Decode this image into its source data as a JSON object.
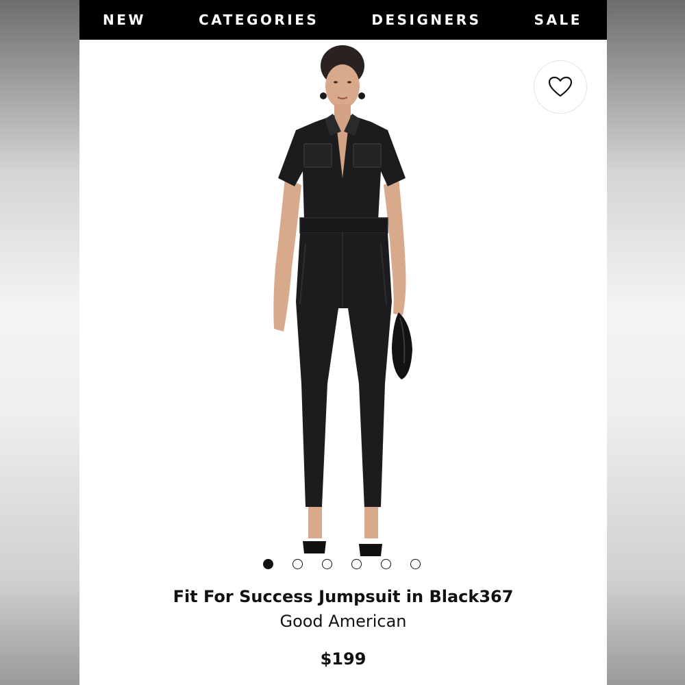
{
  "nav": {
    "items": [
      {
        "label": "NEW"
      },
      {
        "label": "CATEGORIES"
      },
      {
        "label": "DESIGNERS"
      },
      {
        "label": "SALE"
      }
    ]
  },
  "favorite": {
    "icon": "heart-outline-icon"
  },
  "gallery": {
    "image_count": 6,
    "active_index": 0
  },
  "product": {
    "title": "Fit For Success Jumpsuit in Black367",
    "brand": "Good American",
    "price": "$199"
  },
  "colors": {
    "nav_background": "#000000",
    "nav_text": "#ffffff",
    "text": "#111111",
    "garment": "#1c1c1e"
  }
}
